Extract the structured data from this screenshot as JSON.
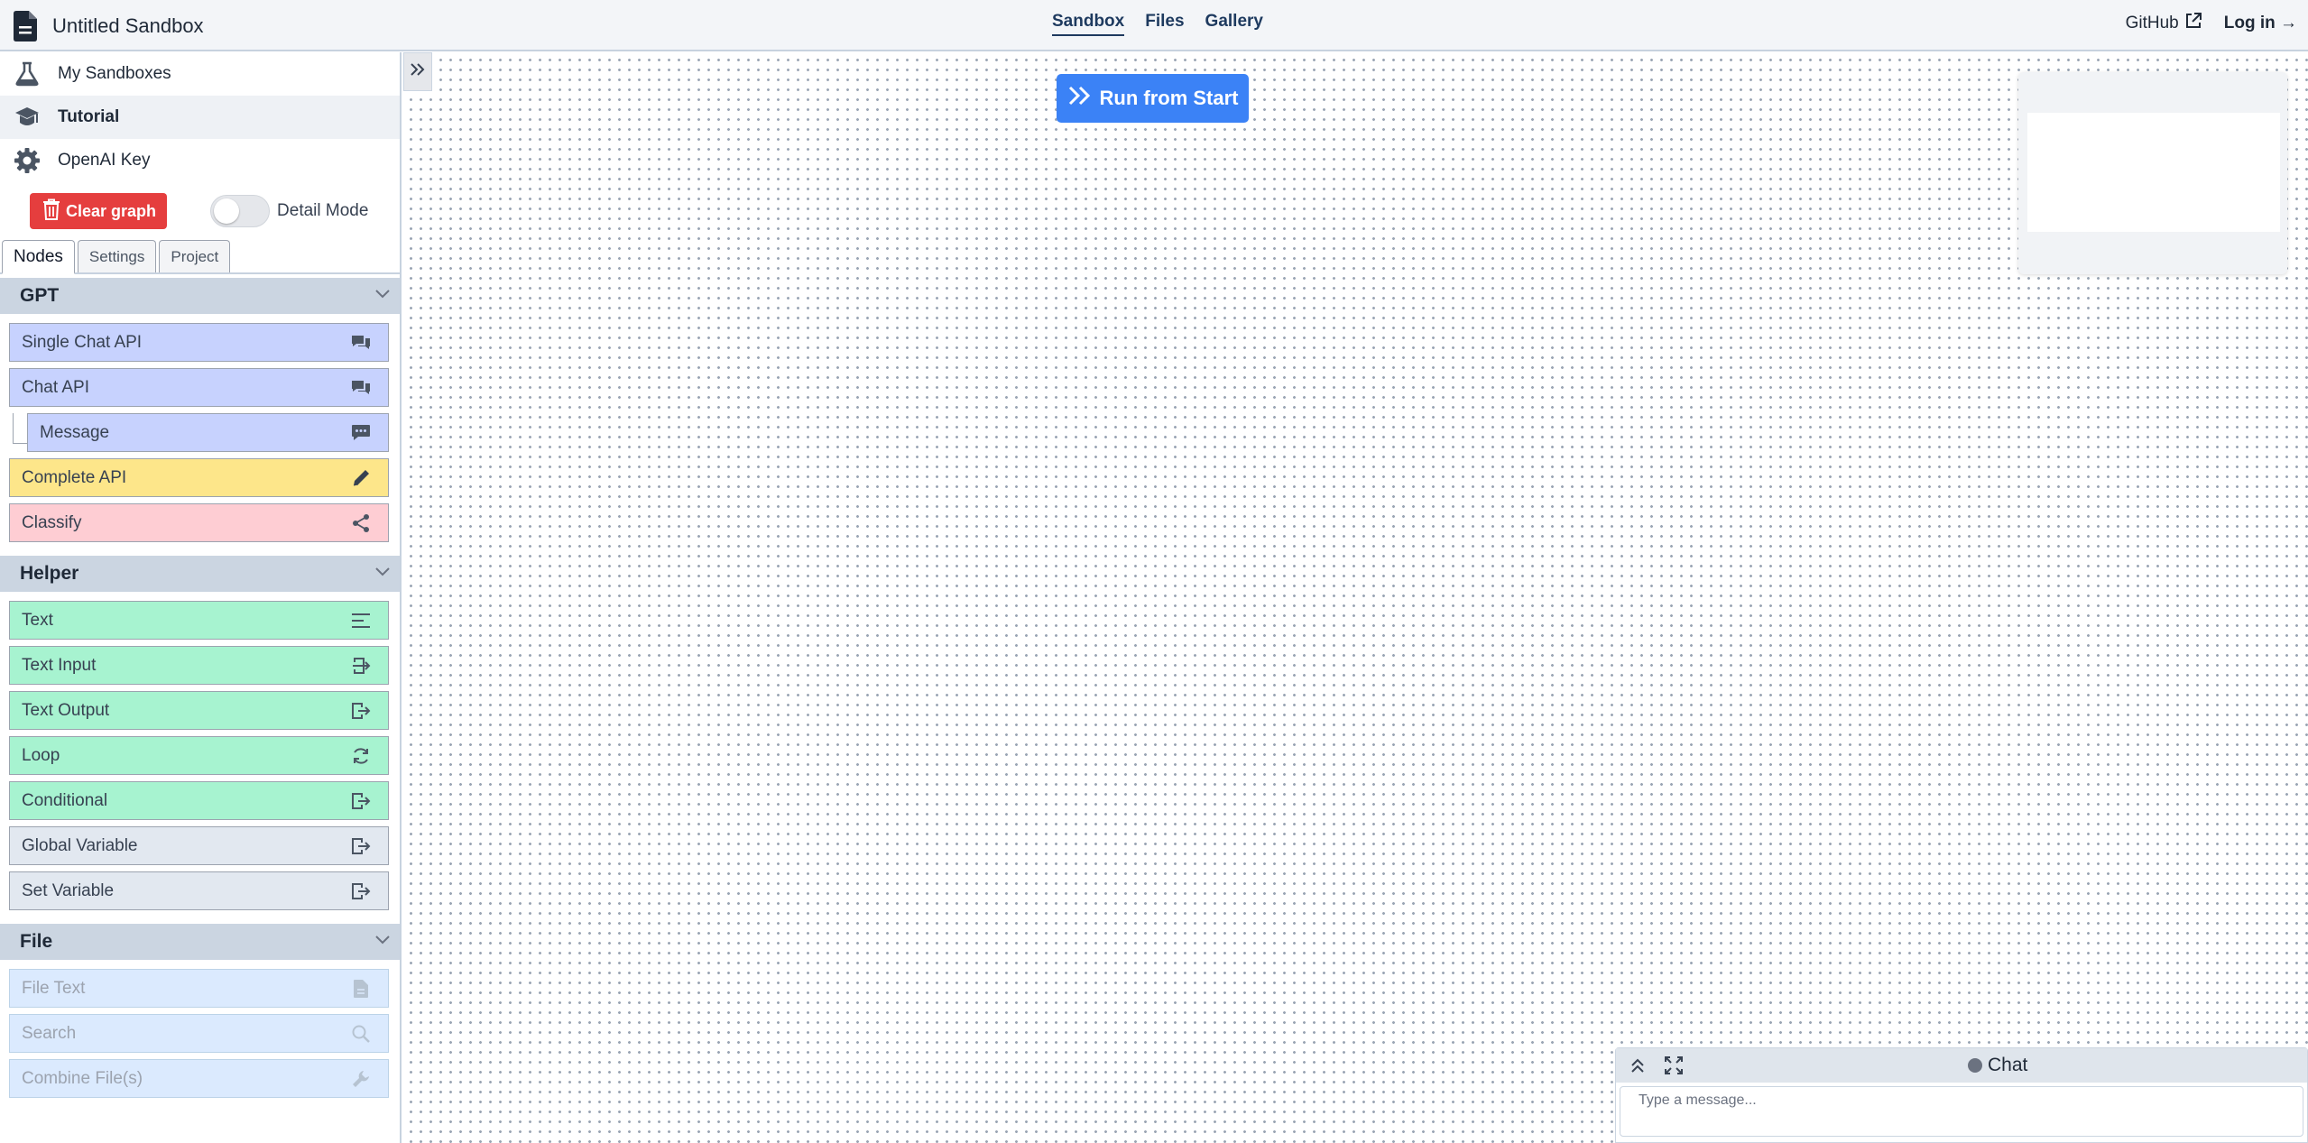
{
  "header": {
    "title": "Untitled Sandbox",
    "nav": [
      "Sandbox",
      "Files",
      "Gallery"
    ],
    "github_label": "GitHub",
    "login_label": "Log in →"
  },
  "sidebar": {
    "menu": [
      {
        "label": "My Sandboxes",
        "icon": "flask-icon"
      },
      {
        "label": "Tutorial",
        "icon": "graduation-cap-icon"
      },
      {
        "label": "OpenAI Key",
        "icon": "gear-icon"
      }
    ],
    "clear_label": "Clear graph",
    "detail_mode_label": "Detail Mode",
    "detail_mode_on": false,
    "tabs": [
      "Nodes",
      "Settings",
      "Project"
    ],
    "groups": [
      {
        "title": "GPT",
        "nodes": [
          {
            "label": "Single Chat API",
            "icon": "comments-icon"
          },
          {
            "label": "Chat API",
            "icon": "comments-icon"
          },
          {
            "label": "Message",
            "icon": "comment-dots-icon"
          },
          {
            "label": "Complete API",
            "icon": "pencil-icon"
          },
          {
            "label": "Classify",
            "icon": "share-nodes-icon"
          }
        ]
      },
      {
        "title": "Helper",
        "nodes": [
          {
            "label": "Text",
            "icon": "align-left-icon"
          },
          {
            "label": "Text Input",
            "icon": "sign-in-icon"
          },
          {
            "label": "Text Output",
            "icon": "sign-out-icon"
          },
          {
            "label": "Loop",
            "icon": "refresh-icon"
          },
          {
            "label": "Conditional",
            "icon": "sign-out-icon"
          },
          {
            "label": "Global Variable",
            "icon": "sign-out-icon"
          },
          {
            "label": "Set Variable",
            "icon": "sign-out-icon"
          }
        ]
      },
      {
        "title": "File",
        "nodes": [
          {
            "label": "File Text",
            "icon": "file-icon"
          },
          {
            "label": "Search",
            "icon": "search-icon"
          },
          {
            "label": "Combine File(s)",
            "icon": "wrench-icon"
          }
        ]
      }
    ]
  },
  "canvas": {
    "run_label": "Run from Start"
  },
  "chat": {
    "title": "Chat",
    "placeholder": "Type a message..."
  },
  "colors": {
    "run_button": "#3b82f6",
    "clear_button": "#e53e3e",
    "gpt_node": "#c7d2fe",
    "complete_node": "#fde68a",
    "classify_node": "#fecdd3",
    "helper_node": "#a7f3d0",
    "variable_node": "#e2e8f0",
    "file_node": "#dbeafe"
  }
}
